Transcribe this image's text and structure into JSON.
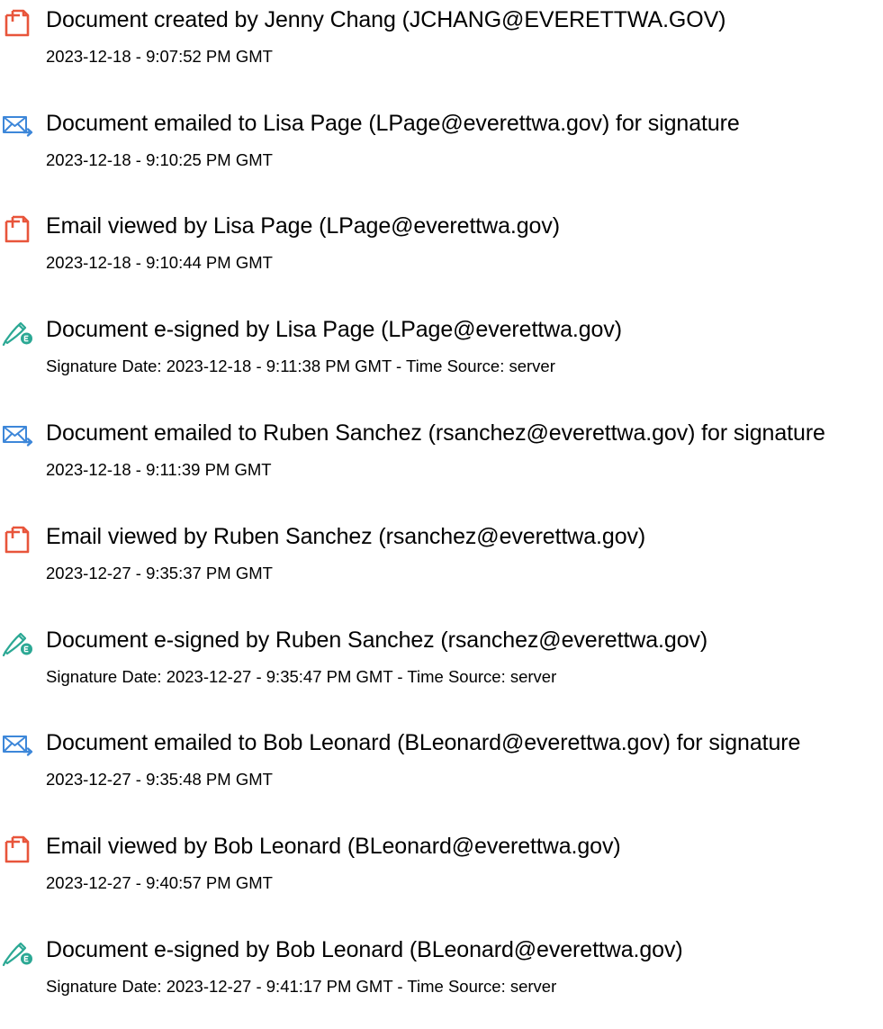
{
  "colors": {
    "text": "#000000",
    "document_icon": "#e8553b",
    "email_icon": "#3d87d9",
    "signed_icon": "#2ba894"
  },
  "events": [
    {
      "icon": "document-icon",
      "title": "Document created by Jenny Chang (JCHANG@EVERETTWA.GOV)",
      "detail": "2023-12-18 - 9:07:52 PM GMT"
    },
    {
      "icon": "email-sent-icon",
      "title": "Document emailed to Lisa Page (LPage@everettwa.gov) for signature",
      "detail": "2023-12-18 - 9:10:25 PM GMT"
    },
    {
      "icon": "document-icon",
      "title": "Email viewed by Lisa Page (LPage@everettwa.gov)",
      "detail": "2023-12-18 - 9:10:44 PM GMT"
    },
    {
      "icon": "esign-pen-icon",
      "title": "Document e-signed by Lisa Page (LPage@everettwa.gov)",
      "detail": "Signature Date: 2023-12-18 - 9:11:38 PM GMT - Time Source: server"
    },
    {
      "icon": "email-sent-icon",
      "title": "Document emailed to Ruben Sanchez (rsanchez@everettwa.gov) for signature",
      "detail": "2023-12-18 - 9:11:39 PM GMT"
    },
    {
      "icon": "document-icon",
      "title": "Email viewed by Ruben Sanchez (rsanchez@everettwa.gov)",
      "detail": "2023-12-27 - 9:35:37 PM GMT"
    },
    {
      "icon": "esign-pen-icon",
      "title": "Document e-signed by Ruben Sanchez (rsanchez@everettwa.gov)",
      "detail": "Signature Date: 2023-12-27 - 9:35:47 PM GMT - Time Source: server"
    },
    {
      "icon": "email-sent-icon",
      "title": "Document emailed to Bob Leonard (BLeonard@everettwa.gov) for signature",
      "detail": "2023-12-27 - 9:35:48 PM GMT"
    },
    {
      "icon": "document-icon",
      "title": "Email viewed by Bob Leonard (BLeonard@everettwa.gov)",
      "detail": "2023-12-27 - 9:40:57 PM GMT"
    },
    {
      "icon": "esign-pen-icon",
      "title": "Document e-signed by Bob Leonard (BLeonard@everettwa.gov)",
      "detail": "Signature Date: 2023-12-27 - 9:41:17 PM GMT - Time Source: server"
    }
  ]
}
